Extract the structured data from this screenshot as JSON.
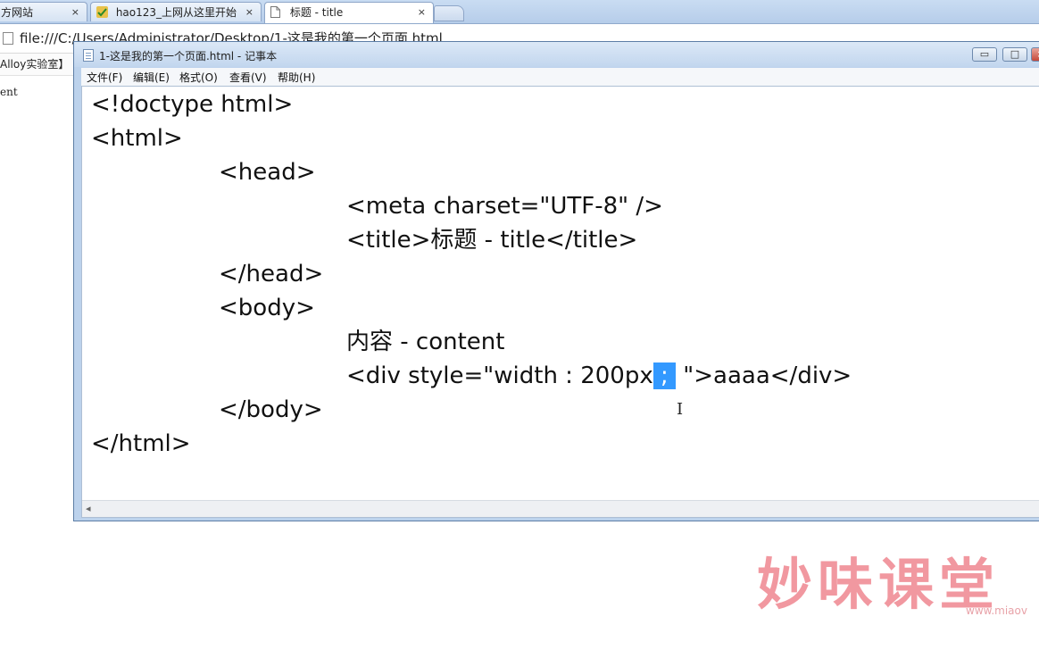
{
  "browser": {
    "tabs": [
      {
        "label": "方网站",
        "close": "×"
      },
      {
        "label": "hao123_上网从这里开始",
        "close": "×"
      },
      {
        "label": "标题 - title",
        "close": "×"
      }
    ],
    "address": "file:///C:/Users/Administrator/Desktop/1-这是我的第一个页面.html",
    "bookmark_text": "Alloy实验室】 H",
    "page_text": "ent"
  },
  "notepad": {
    "title": "1-这是我的第一个页面.html - 记事本",
    "window_buttons": {
      "minimize": "▭",
      "maximize": "□",
      "close": "×"
    },
    "menu": [
      "文件(F)",
      "编辑(E)",
      "格式(O)",
      "查看(V)",
      "帮助(H)"
    ],
    "code": {
      "l1": "<!doctype html>",
      "l2": "<html>",
      "l3": "<head>",
      "l4": "<meta charset=\"UTF-8\" />",
      "l5": "<title>标题 - title</title>",
      "l6": "</head>",
      "l7": "<body>",
      "l8": "内容 - content",
      "l9_before": "<div style=\"width : 200px",
      "l9_selected": " ; ",
      "l9_after": " \">aaaa</div>",
      "l10": "</body>",
      "l11": "</html>"
    },
    "scroll_arrow": "◂"
  },
  "cursor_glyph": "I",
  "watermark": {
    "text": "妙味课堂",
    "url": "www.miaov"
  }
}
